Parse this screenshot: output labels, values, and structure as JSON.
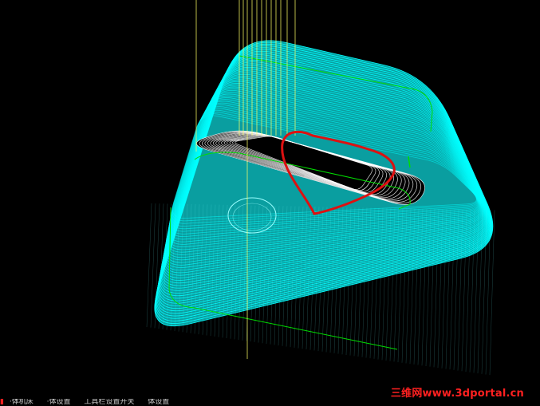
{
  "viewport": {
    "background": "#000000",
    "colors": {
      "toolpath": "#00ffff",
      "tool_shank": "#ffff66",
      "profile_curve": "#00dd00",
      "heart_curve": "#dd1111",
      "pocket_fill": "#000000"
    },
    "objects": [
      "toolpath-shell",
      "pocket-toolpath",
      "heart-curve",
      "tool-lines",
      "green-profile",
      "boss-circle"
    ]
  },
  "watermark": {
    "text": "三维网www.3dportal.cn",
    "color": "#ff2020"
  },
  "statusbar": {
    "mark": "▮",
    "text_1": "·体机床",
    "text_2": "·体设置",
    "text_3": "工具栏设置开关",
    "text_4": "体设置"
  }
}
